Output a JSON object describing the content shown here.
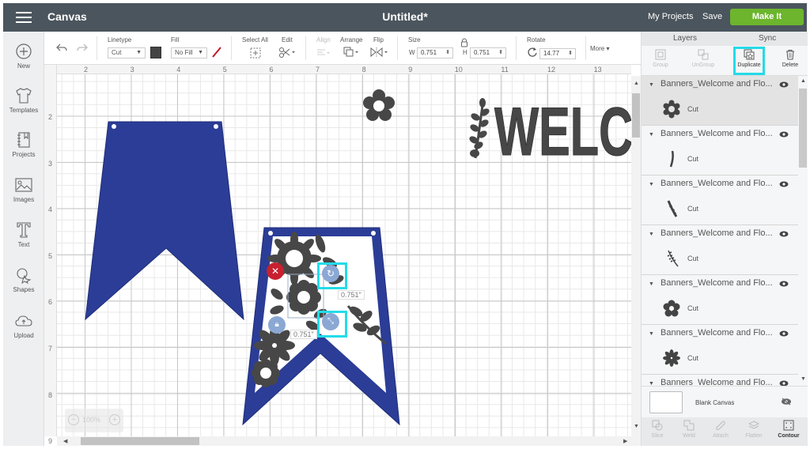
{
  "topbar": {
    "app_title": "Canvas",
    "doc_title": "Untitled*",
    "my_projects": "My Projects",
    "save": "Save",
    "make_it": "Make It",
    "make_it_color": "#6cb52d"
  },
  "sidebar": {
    "items": [
      {
        "label": "New",
        "icon": "plus-circle-icon"
      },
      {
        "label": "Templates",
        "icon": "tshirt-icon"
      },
      {
        "label": "Projects",
        "icon": "notebook-icon"
      },
      {
        "label": "Images",
        "icon": "image-icon"
      },
      {
        "label": "Text",
        "icon": "text-t-icon"
      },
      {
        "label": "Shapes",
        "icon": "shapes-icon"
      },
      {
        "label": "Upload",
        "icon": "cloud-upload-icon"
      }
    ]
  },
  "toolbar": {
    "linetype_label": "Linetype",
    "linetype_value": "Cut",
    "linetype_color": "#444444",
    "fill_label": "Fill",
    "fill_value": "No Fill",
    "select_all_label": "Select All",
    "edit_label": "Edit",
    "align_label": "Align",
    "arrange_label": "Arrange",
    "flip_label": "Flip",
    "size_label": "Size",
    "w_label": "W",
    "w_value": "0.751",
    "h_label": "H",
    "h_value": "0.751",
    "rotate_label": "Rotate",
    "rotate_value": "14.77",
    "more_label": "More"
  },
  "ruler": {
    "top": [
      "2",
      "3",
      "4",
      "5",
      "6",
      "7",
      "8",
      "9",
      "10",
      "11",
      "12",
      "13"
    ],
    "left": [
      "2",
      "3",
      "4",
      "5",
      "6",
      "7",
      "8",
      "9"
    ]
  },
  "canvas": {
    "welcome_text": "WELC",
    "dim_width": "0.751\"",
    "dim_height": "0.751\"",
    "banner_color": "#2b3d96",
    "shape_color": "#464646",
    "zoom_level": "100%"
  },
  "panel": {
    "tabs": [
      "Layers",
      "Sync"
    ],
    "actions": [
      {
        "label": "Group",
        "enabled": false
      },
      {
        "label": "UnGroup",
        "enabled": false
      },
      {
        "label": "Duplicate",
        "enabled": true
      },
      {
        "label": "Delete",
        "enabled": true
      }
    ],
    "layers": [
      {
        "name": "Banners_Welcome and Flo...",
        "type": "Cut",
        "thumb": "flower-gear",
        "selected": true
      },
      {
        "name": "Banners_Welcome and Flo...",
        "type": "Cut",
        "thumb": "leaf-stem",
        "selected": false
      },
      {
        "name": "Banners_Welcome and Flo...",
        "type": "Cut",
        "thumb": "leaf-branch",
        "selected": false
      },
      {
        "name": "Banners_Welcome and Flo...",
        "type": "Cut",
        "thumb": "leaf-sprig",
        "selected": false
      },
      {
        "name": "Banners_Welcome and Flo...",
        "type": "Cut",
        "thumb": "flower-round",
        "selected": false
      },
      {
        "name": "Banners_Welcome and Flo...",
        "type": "Cut",
        "thumb": "flower-star",
        "selected": false
      },
      {
        "name": "Banners_Welcome and Flo...",
        "type": "",
        "thumb": "",
        "selected": false
      }
    ],
    "blank_canvas_label": "Blank Canvas",
    "bottom_actions": [
      {
        "label": "Slice",
        "enabled": false
      },
      {
        "label": "Weld",
        "enabled": false
      },
      {
        "label": "Attach",
        "enabled": false
      },
      {
        "label": "Flatten",
        "enabled": false
      },
      {
        "label": "Contour",
        "enabled": true
      }
    ]
  }
}
